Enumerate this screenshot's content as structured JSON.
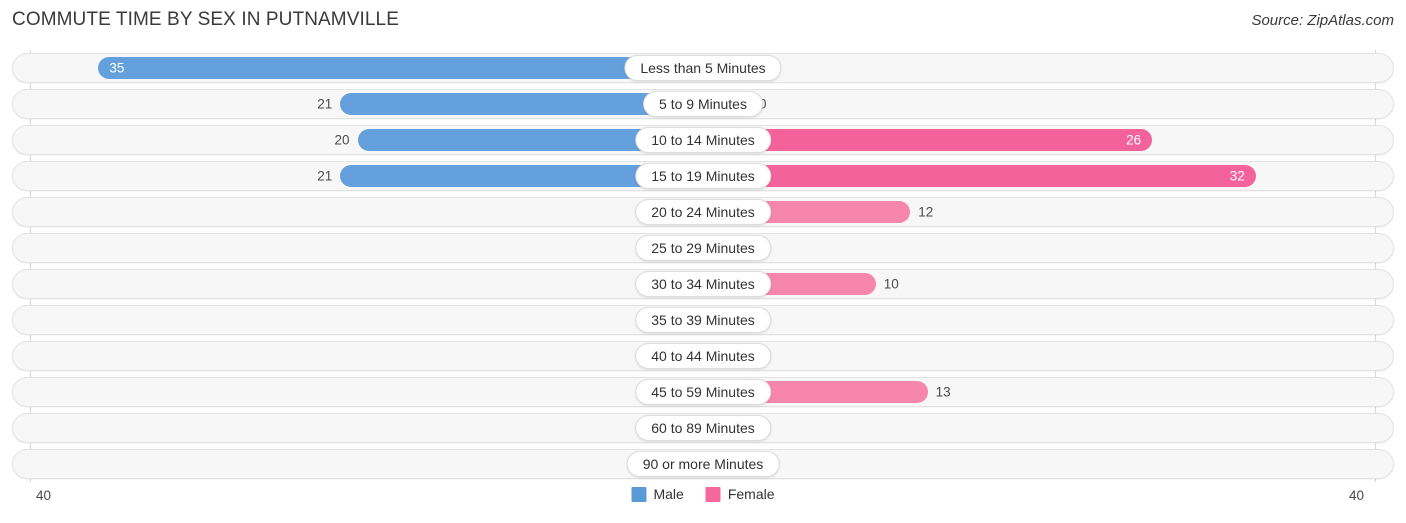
{
  "header": {
    "title": "COMMUTE TIME BY SEX IN PUTNAMVILLE",
    "source": "Source: ZipAtlas.com"
  },
  "axis": {
    "left_label": "40",
    "right_label": "40",
    "max": 40
  },
  "legend": {
    "items": [
      {
        "label": "Male",
        "color": "#5b9bd5"
      },
      {
        "label": "Female",
        "color": "#f4689e"
      }
    ]
  },
  "colors": {
    "male_strong": "#63a0dc",
    "male_light": "#afcdee",
    "female_strong": "#f4629b",
    "female_mid": "#f786ad",
    "female_light": "#f9a8c4",
    "track_bg": "#f7f7f7",
    "track_border": "#e2e2e2",
    "gridline": "#d8d8d8",
    "text": "#4a4a4a"
  },
  "chart_data": {
    "type": "bar",
    "title": "COMMUTE TIME BY SEX IN PUTNAMVILLE",
    "subtitle": "Source: ZipAtlas.com",
    "orientation": "horizontal-diverging",
    "xlabel": "",
    "ylabel": "",
    "xlim": [
      -40,
      40
    ],
    "axis_max": 40,
    "grid": true,
    "legend_position": "bottom-center",
    "categories": [
      "Less than 5 Minutes",
      "5 to 9 Minutes",
      "10 to 14 Minutes",
      "15 to 19 Minutes",
      "20 to 24 Minutes",
      "25 to 29 Minutes",
      "30 to 34 Minutes",
      "35 to 39 Minutes",
      "40 to 44 Minutes",
      "45 to 59 Minutes",
      "60 to 89 Minutes",
      "90 or more Minutes"
    ],
    "series": [
      {
        "name": "Male",
        "color": "#5b9bd5",
        "values": [
          35,
          21,
          20,
          21,
          0,
          0,
          0,
          0,
          0,
          0,
          0,
          0
        ]
      },
      {
        "name": "Female",
        "color": "#f4689e",
        "values": [
          0,
          0,
          26,
          32,
          12,
          0,
          10,
          0,
          0,
          13,
          0,
          0
        ]
      }
    ]
  },
  "rows": [
    {
      "category": "Less than 5 Minutes",
      "male": "35",
      "female": "0",
      "male_value": 35,
      "female_value": 0
    },
    {
      "category": "5 to 9 Minutes",
      "male": "21",
      "female": "0",
      "male_value": 21,
      "female_value": 0
    },
    {
      "category": "10 to 14 Minutes",
      "male": "20",
      "female": "26",
      "male_value": 20,
      "female_value": 26
    },
    {
      "category": "15 to 19 Minutes",
      "male": "21",
      "female": "32",
      "male_value": 21,
      "female_value": 32
    },
    {
      "category": "20 to 24 Minutes",
      "male": "0",
      "female": "12",
      "male_value": 0,
      "female_value": 12
    },
    {
      "category": "25 to 29 Minutes",
      "male": "0",
      "female": "0",
      "male_value": 0,
      "female_value": 0
    },
    {
      "category": "30 to 34 Minutes",
      "male": "0",
      "female": "10",
      "male_value": 0,
      "female_value": 10
    },
    {
      "category": "35 to 39 Minutes",
      "male": "0",
      "female": "0",
      "male_value": 0,
      "female_value": 0
    },
    {
      "category": "40 to 44 Minutes",
      "male": "0",
      "female": "0",
      "male_value": 0,
      "female_value": 0
    },
    {
      "category": "45 to 59 Minutes",
      "male": "0",
      "female": "13",
      "male_value": 0,
      "female_value": 13
    },
    {
      "category": "60 to 89 Minutes",
      "male": "0",
      "female": "0",
      "male_value": 0,
      "female_value": 0
    },
    {
      "category": "90 or more Minutes",
      "male": "0",
      "female": "0",
      "male_value": 0,
      "female_value": 0
    }
  ]
}
